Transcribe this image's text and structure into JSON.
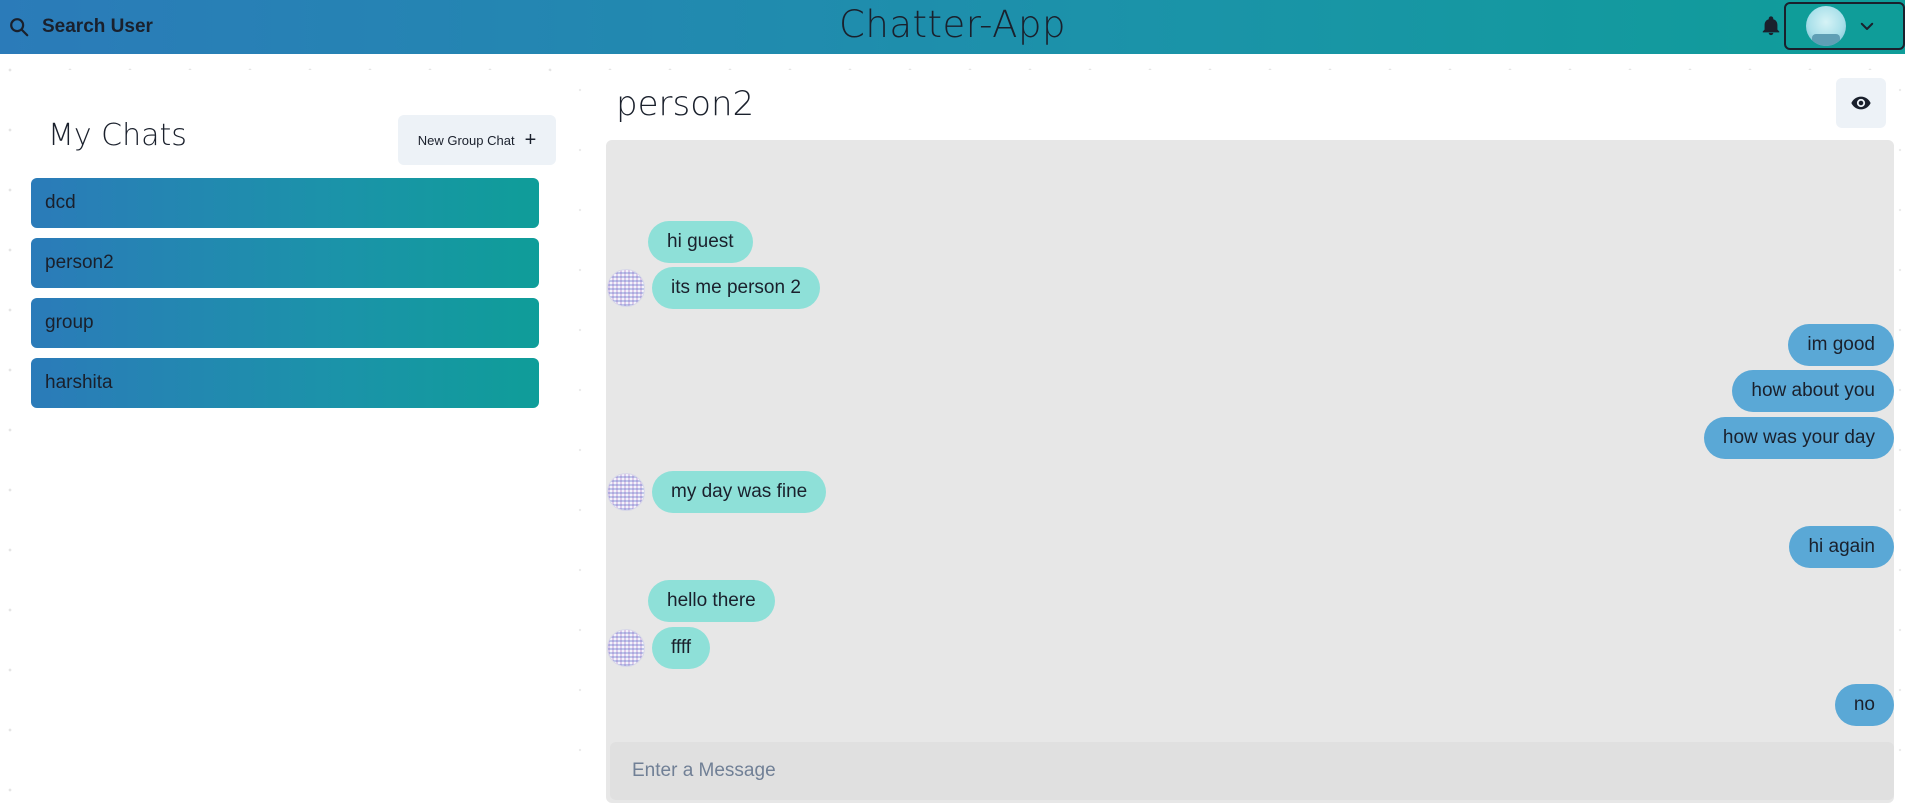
{
  "header": {
    "search_label": "Search User",
    "app_title": "Chatter-App"
  },
  "icons": {
    "search": "search-icon",
    "bell": "bell-icon",
    "avatar": "user-avatar",
    "chevron": "chevron-down-icon",
    "eye": "eye-icon",
    "plus": "plus-icon"
  },
  "colors": {
    "header_gradient_start": "#2b7bb9",
    "header_gradient_end": "#0f9d99",
    "incoming_bubble": "#8ee0d8",
    "outgoing_bubble": "#5aa8d6",
    "messages_bg": "#e7e7e7"
  },
  "my_chats": {
    "title": "My Chats",
    "new_group_label": "New Group Chat",
    "new_group_plus": "+",
    "chats": [
      {
        "name": "dcd"
      },
      {
        "name": "person2"
      },
      {
        "name": "group"
      },
      {
        "name": "harshita"
      }
    ]
  },
  "chat": {
    "title": "person2",
    "messages": [
      {
        "text": "hi guest",
        "dir": "in",
        "avatar": false
      },
      {
        "text": "its me person 2",
        "dir": "in",
        "avatar": true
      },
      {
        "text": "im good",
        "dir": "out"
      },
      {
        "text": "how about you",
        "dir": "out"
      },
      {
        "text": "how was your day",
        "dir": "out"
      },
      {
        "text": "my day was fine",
        "dir": "in",
        "avatar": true
      },
      {
        "text": "hi again",
        "dir": "out"
      },
      {
        "text": "hello there",
        "dir": "in",
        "avatar": false
      },
      {
        "text": "ffff",
        "dir": "in",
        "avatar": true
      },
      {
        "text": "no",
        "dir": "out"
      }
    ],
    "input_placeholder": "Enter a Message",
    "input_value": ""
  }
}
